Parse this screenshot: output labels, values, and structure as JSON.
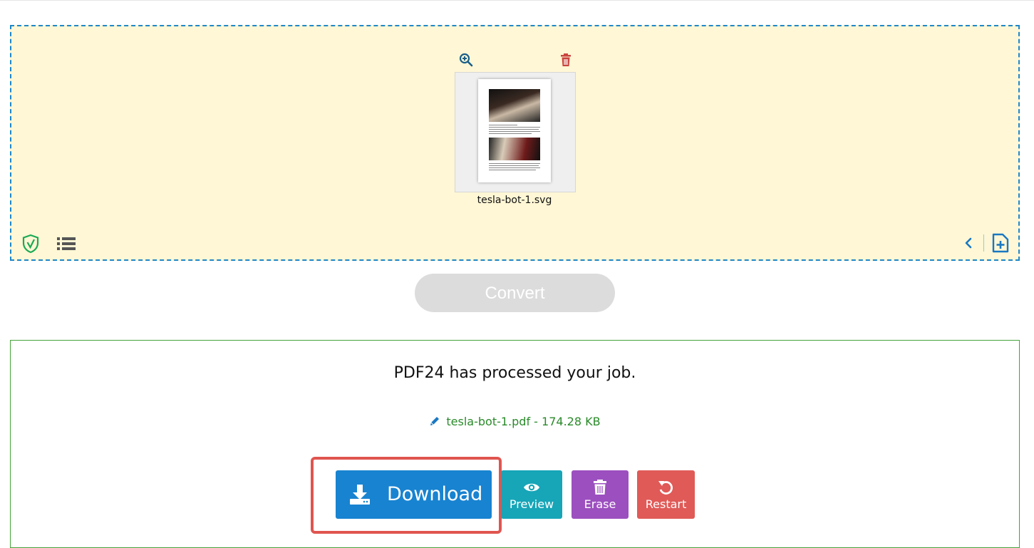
{
  "dropzone": {
    "file": {
      "name": "tesla-bot-1.svg"
    }
  },
  "convert": {
    "label": "Convert"
  },
  "result": {
    "title": "PDF24 has processed your job.",
    "file_info": "tesla-bot-1.pdf - 174.28 KB",
    "buttons": {
      "download": "Download",
      "preview": "Preview",
      "erase": "Erase",
      "restart": "Restart"
    }
  },
  "colors": {
    "dropzone_bg": "#fff7d5",
    "dropzone_border": "#1e87c8",
    "result_border": "#45a33a",
    "download": "#1883d0",
    "preview": "#17a5b8",
    "erase": "#9c4fbf",
    "restart": "#e05a57",
    "highlight": "#e05550"
  },
  "icons": [
    "zoom-in-icon",
    "trash-icon",
    "shield-check-icon",
    "list-icon",
    "chevron-left-icon",
    "add-file-icon",
    "pencil-icon",
    "download-icon",
    "eye-icon",
    "restart-icon"
  ]
}
